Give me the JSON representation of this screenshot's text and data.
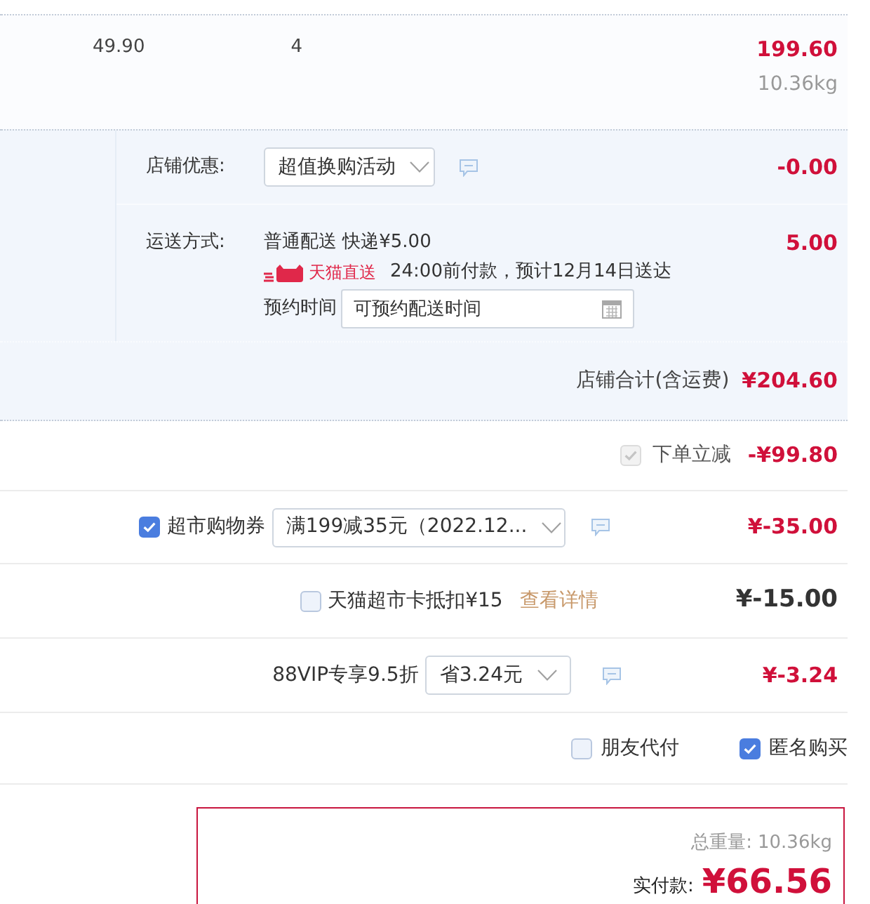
{
  "item": {
    "unit_price": "49.90",
    "quantity": "4",
    "subtotal": "199.60",
    "weight": "10.36kg"
  },
  "shop": {
    "promo": {
      "label": "店铺优惠:",
      "option": "超值换购活动",
      "amount": "-0.00"
    },
    "shipping": {
      "label": "运送方式:",
      "method": "普通配送 快递¥5.00",
      "amount": "5.00",
      "badge": "天猫直送",
      "eta": "24:00前付款，预计12月14日送达",
      "schedule_label": "预约时间",
      "schedule_placeholder": "可预约配送时间"
    },
    "total": {
      "label": "店铺合计(含运费)",
      "amount": "¥204.60"
    }
  },
  "adjustments": [
    {
      "kind": "instant",
      "checked": true,
      "disabled": true,
      "label": "下单立减",
      "amount": "-¥99.80"
    },
    {
      "kind": "coupon",
      "checked": true,
      "disabled": false,
      "label": "超市购物券",
      "option": "满199减35元（2022.12...",
      "amount": "¥-35.00"
    },
    {
      "kind": "card",
      "checked": false,
      "disabled": false,
      "label": "天猫超市卡抵扣¥15",
      "link": "查看详情",
      "amount": "¥-15.00"
    },
    {
      "kind": "vip",
      "label": "88VIP专享9.5折",
      "option": "省3.24元",
      "amount": "¥-3.24"
    }
  ],
  "options": [
    {
      "label": "朋友代付",
      "checked": false
    },
    {
      "label": "匿名购买",
      "checked": true
    }
  ],
  "summary": {
    "weight_label": "总重量:",
    "weight": "10.36kg",
    "pay_label": "实付款:",
    "pay": "¥66.56"
  }
}
